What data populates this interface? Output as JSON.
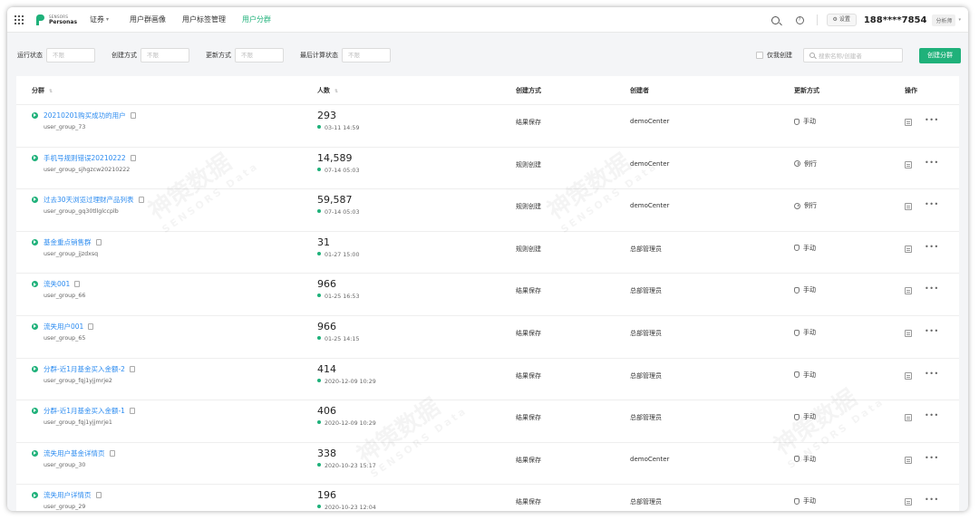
{
  "header": {
    "logo_top": "SENSORS",
    "logo_bottom": "Personas",
    "product": "证券",
    "nav": [
      {
        "label": "用户群画像",
        "active": false
      },
      {
        "label": "用户标签管理",
        "active": false
      },
      {
        "label": "用户分群",
        "active": true
      }
    ],
    "settings_label": "设置",
    "phone": "188****7854",
    "role": "分析师"
  },
  "filters": {
    "run_status": {
      "label": "运行状态",
      "placeholder": "不限"
    },
    "create_method": {
      "label": "创建方式",
      "placeholder": "不限"
    },
    "update_method": {
      "label": "更新方式",
      "placeholder": "不限"
    },
    "last_calc_status": {
      "label": "最后计算状态",
      "placeholder": "不限"
    },
    "mine_only_label": "仅我创建",
    "search_placeholder": "搜索名称/创建者",
    "create_button": "创建分群"
  },
  "table": {
    "columns": {
      "group": "分群",
      "count": "人数",
      "method": "创建方式",
      "creator": "创建者",
      "update": "更新方式",
      "actions": "操作"
    },
    "rows": [
      {
        "name": "20210201购买成功的用户",
        "id": "user_group_73",
        "count": "293",
        "date": "03-11 14:59",
        "method": "结果保存",
        "creator": "demoCenter",
        "update": "手动",
        "update_icon": "hand-icon"
      },
      {
        "name": "手机号规则错误20210222",
        "id": "user_group_sjhgzcw20210222",
        "count": "14,589",
        "date": "07-14 05:03",
        "method": "规则创建",
        "creator": "demoCenter",
        "update": "例行",
        "update_icon": "clock-icon"
      },
      {
        "name": "过去30天浏览过理财产品列表",
        "id": "user_group_gq30tllglccplb",
        "count": "59,587",
        "date": "07-14 05:03",
        "method": "规则创建",
        "creator": "demoCenter",
        "update": "例行",
        "update_icon": "clock-icon"
      },
      {
        "name": "基金重点销售群",
        "id": "user_group_jjzdxsq",
        "count": "31",
        "date": "01-27 15:00",
        "method": "规则创建",
        "creator": "总部管理员",
        "update": "手动",
        "update_icon": "hand-icon"
      },
      {
        "name": "流失001",
        "id": "user_group_66",
        "count": "966",
        "date": "01-25 16:53",
        "method": "结果保存",
        "creator": "总部管理员",
        "update": "手动",
        "update_icon": "hand-icon"
      },
      {
        "name": "流失用户001",
        "id": "user_group_65",
        "count": "966",
        "date": "01-25 14:15",
        "method": "结果保存",
        "creator": "总部管理员",
        "update": "手动",
        "update_icon": "hand-icon"
      },
      {
        "name": "分群-近1月基金买入金额-2",
        "id": "user_group_fqj1yjjmrje2",
        "count": "414",
        "date": "2020-12-09 10:29",
        "method": "结果保存",
        "creator": "总部管理员",
        "update": "手动",
        "update_icon": "hand-icon"
      },
      {
        "name": "分群-近1月基金买入金额-1",
        "id": "user_group_fqj1yjjmrje1",
        "count": "406",
        "date": "2020-12-09 10:29",
        "method": "结果保存",
        "creator": "总部管理员",
        "update": "手动",
        "update_icon": "hand-icon"
      },
      {
        "name": "流失用户基金详情页",
        "id": "user_group_30",
        "count": "338",
        "date": "2020-10-23 15:17",
        "method": "结果保存",
        "creator": "demoCenter",
        "update": "手动",
        "update_icon": "hand-icon"
      },
      {
        "name": "流失用户详情页",
        "id": "user_group_29",
        "count": "196",
        "date": "2020-10-23 12:04",
        "method": "结果保存",
        "creator": "总部管理员",
        "update": "手动",
        "update_icon": "hand-icon"
      }
    ]
  },
  "colors": {
    "accent": "#1fb17a",
    "link": "#2d8cf0"
  },
  "watermark": {
    "main": "神策数据",
    "sub": "SENSORS Data"
  }
}
